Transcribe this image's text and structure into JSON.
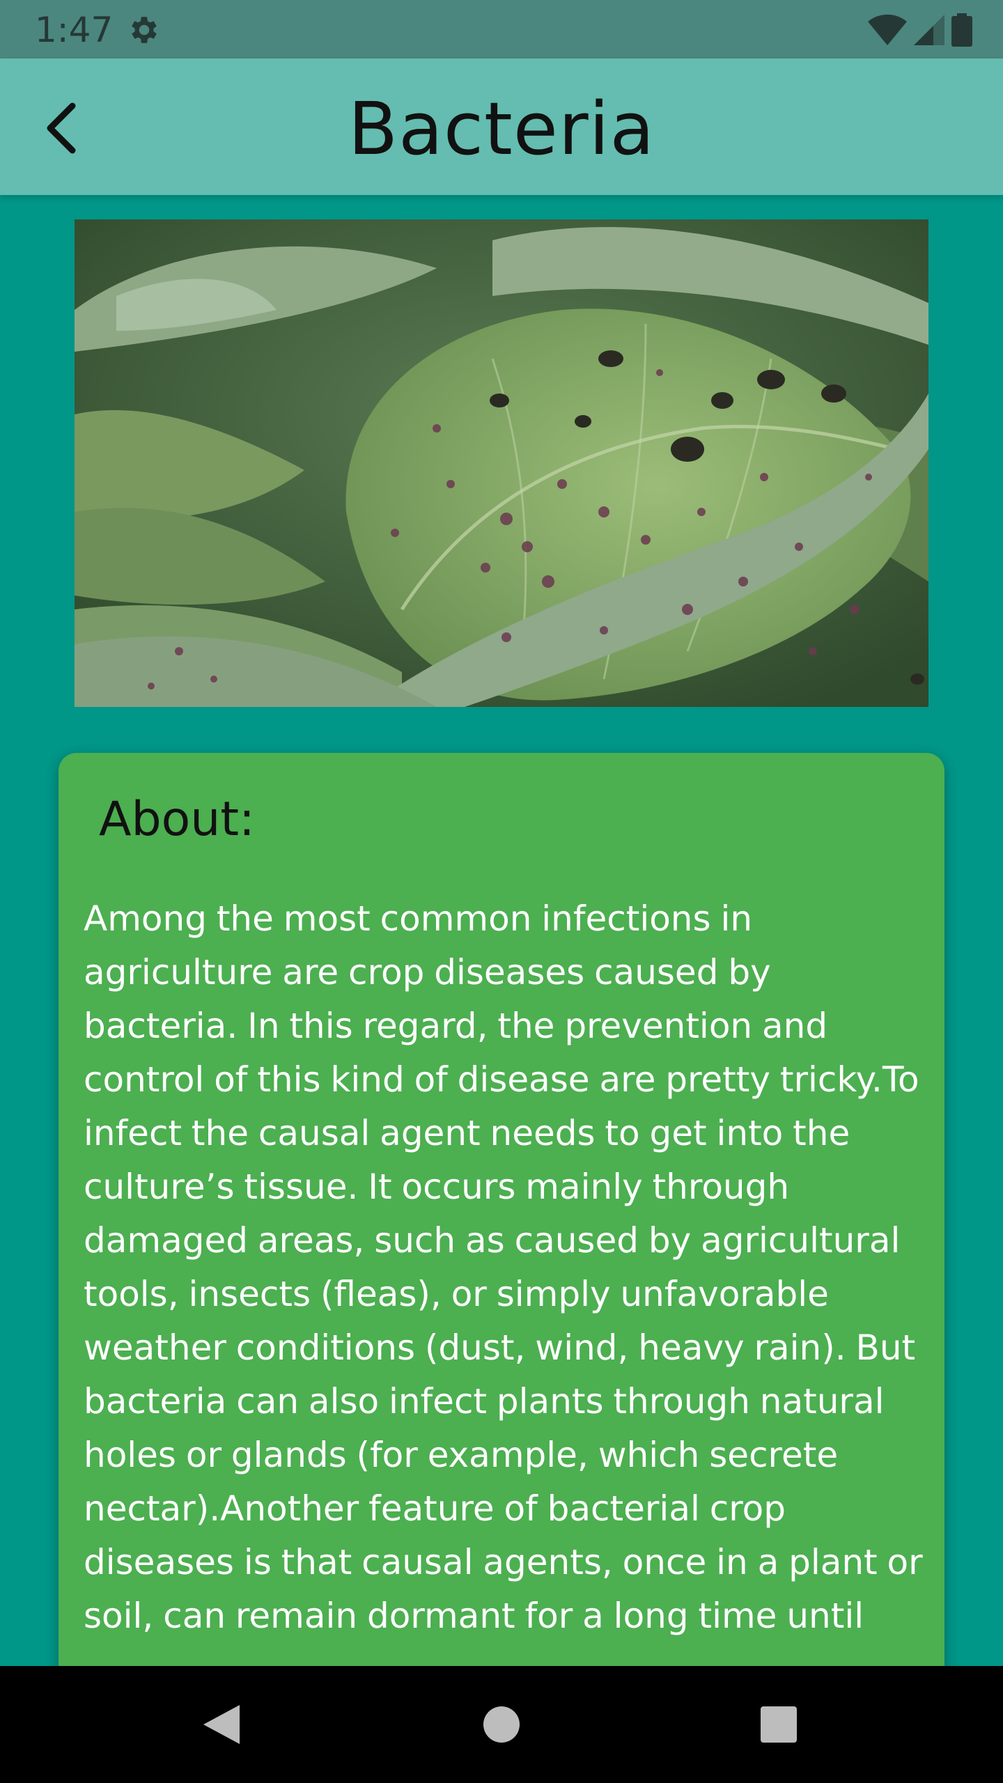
{
  "status_bar": {
    "time": "1:47",
    "icons": [
      "settings-icon",
      "wifi-icon",
      "signal-icon",
      "battery-icon"
    ]
  },
  "app_bar": {
    "title": "Bacteria",
    "back_icon": "back-arrow-icon"
  },
  "photo": {
    "subject": "leaf-disease-photo"
  },
  "about": {
    "heading": "About:",
    "body": "Among the most common infections in agriculture are crop diseases caused by bacteria. In this regard, the prevention and control of this kind of disease are pretty tricky.To infect the causal agent needs to get into the culture’s tissue. It occurs mainly through damaged areas, such as caused by agricultural tools, insects (fleas), or simply unfavorable weather conditions (dust, wind, heavy rain). But bacteria can also infect plants through natural holes or glands (for example, which secrete nectar).Another feature of bacterial crop diseases is that causal agents, once in a plant or soil, can remain dormant for a long time until"
  },
  "nav_bar": {
    "buttons": [
      "back-triangle-icon",
      "home-circle-icon",
      "recents-square-icon"
    ]
  },
  "colors": {
    "background": "#009688",
    "app_bar": "#64bdb0",
    "status_bar": "#4b877f",
    "card": "#4caf50",
    "nav_bar": "#000000"
  }
}
